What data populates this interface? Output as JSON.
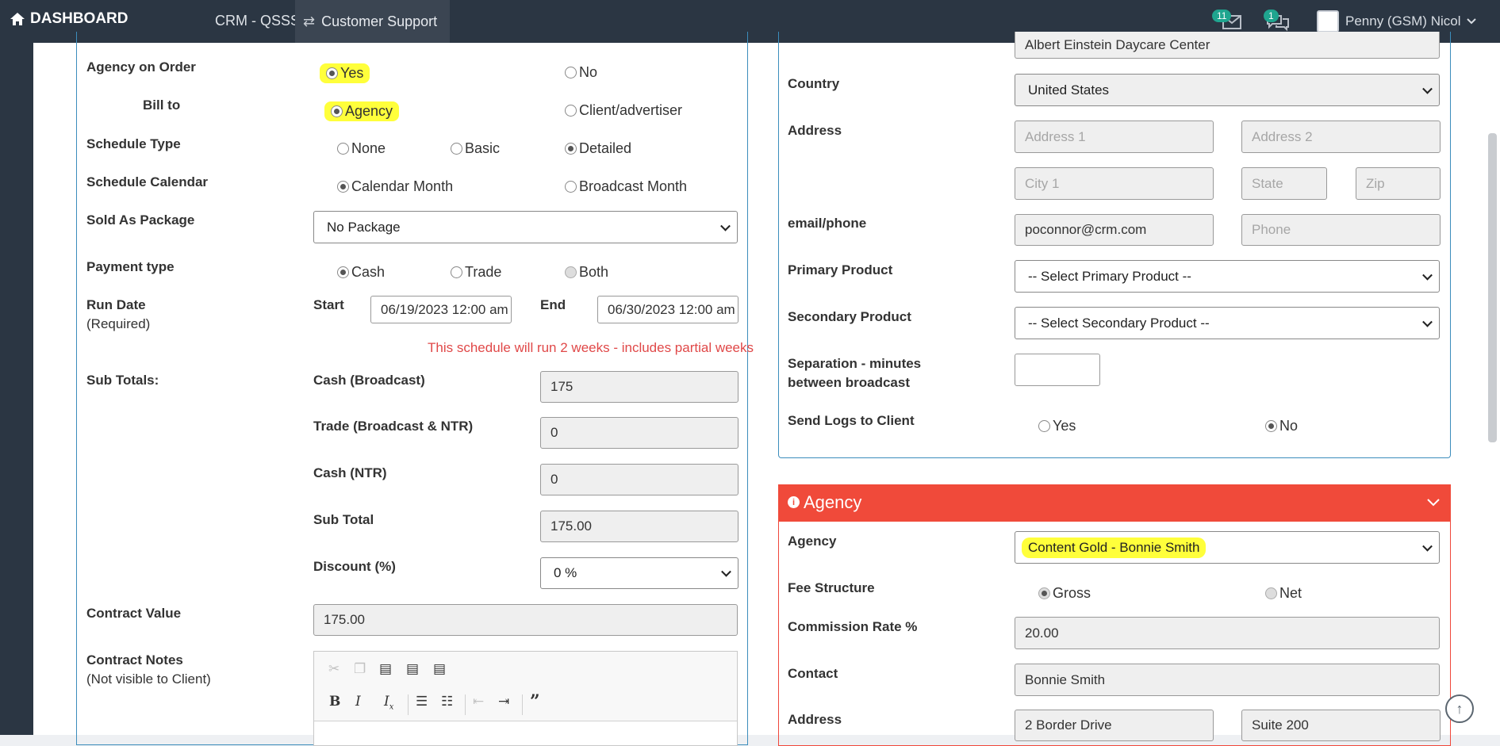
{
  "topbar": {
    "brand": "DASHBOARD",
    "nav_crm": "CRM - QSSS",
    "nav_support": "Customer Support",
    "mail_count": "11",
    "chat_count": "1",
    "user_name": "Penny (GSM) Nicol"
  },
  "left": {
    "agency_on_order": {
      "label": "Agency on Order",
      "yes": "Yes",
      "no": "No",
      "selected": "Yes"
    },
    "bill_to": {
      "label": "Bill to",
      "agency": "Agency",
      "client": "Client/advertiser",
      "selected": "Agency"
    },
    "schedule_type": {
      "label": "Schedule Type",
      "none": "None",
      "basic": "Basic",
      "detailed": "Detailed",
      "selected": "Detailed"
    },
    "schedule_calendar": {
      "label": "Schedule Calendar",
      "calendar": "Calendar Month",
      "broadcast": "Broadcast Month",
      "selected": "Calendar Month"
    },
    "sold_as_package": {
      "label": "Sold As Package",
      "value": "No Package"
    },
    "payment_type": {
      "label": "Payment type",
      "cash": "Cash",
      "trade": "Trade",
      "both": "Both",
      "selected": "Cash"
    },
    "run_date": {
      "label": "Run Date",
      "required": "(Required)",
      "start_label": "Start",
      "start_value": "06/19/2023 12:00 am",
      "end_label": "End",
      "end_value": "06/30/2023 12:00 am",
      "note": "This schedule will run 2 weeks - includes partial weeks"
    },
    "sub_totals": {
      "label": "Sub Totals:",
      "cash_broadcast_label": "Cash (Broadcast)",
      "cash_broadcast": "175",
      "trade_label": "Trade (Broadcast & NTR)",
      "trade": "0",
      "cash_ntr_label": "Cash (NTR)",
      "cash_ntr": "0",
      "sub_total_label": "Sub Total",
      "sub_total": "175.00",
      "discount_label": "Discount (%)",
      "discount": "0 %"
    },
    "contract_value": {
      "label": "Contract Value",
      "value": "175.00"
    },
    "contract_notes": {
      "label": "Contract Notes",
      "sub": "(Not visible to Client)"
    }
  },
  "right": {
    "company_value": "Albert Einstein Daycare Center",
    "country": {
      "label": "Country",
      "value": "United States"
    },
    "address": {
      "label": "Address",
      "address1": "Address 1",
      "address2": "Address 2",
      "city": "City 1",
      "state": "State",
      "zip": "Zip"
    },
    "email_phone": {
      "label": "email/phone",
      "email": "poconnor@crm.com",
      "phone": "Phone"
    },
    "primary_product": {
      "label": "Primary Product",
      "value": "-- Select Primary Product --"
    },
    "secondary_product": {
      "label": "Secondary Product",
      "value": "-- Select Secondary Product --"
    },
    "separation": {
      "label_line1": "Separation - minutes",
      "label_line2": "between broadcast",
      "value": ""
    },
    "send_logs": {
      "label": "Send Logs to Client",
      "yes": "Yes",
      "no": "No",
      "selected": "No"
    }
  },
  "agency_panel": {
    "title": "Agency",
    "agency": {
      "label": "Agency",
      "value": "Content Gold - Bonnie Smith"
    },
    "fee_structure": {
      "label": "Fee Structure",
      "gross": "Gross",
      "net": "Net",
      "selected": "Gross"
    },
    "commission": {
      "label": "Commission Rate %",
      "value": "20.00"
    },
    "contact": {
      "label": "Contact",
      "value": "Bonnie Smith"
    },
    "address": {
      "label": "Address",
      "address1": "2 Border Drive",
      "address2": "Suite 200"
    }
  },
  "colors": {
    "topbar": "#2b3643",
    "panel_border": "#3c8dbc",
    "agency_header": "#f04a3a",
    "highlight": "#ffff3b",
    "badge": "#1fa58f",
    "note_red": "#e04848"
  },
  "icons": [
    "home-icon",
    "exchange-icon",
    "envelope-icon",
    "comments-icon",
    "chevron-down-icon",
    "info-circle-icon",
    "arrow-up-circle-icon",
    "cut-icon",
    "copy-icon",
    "paste-icon",
    "bold-icon",
    "italic-icon",
    "remove-format-icon",
    "numbered-list-icon",
    "bullet-list-icon",
    "outdent-icon",
    "indent-icon",
    "blockquote-icon"
  ]
}
